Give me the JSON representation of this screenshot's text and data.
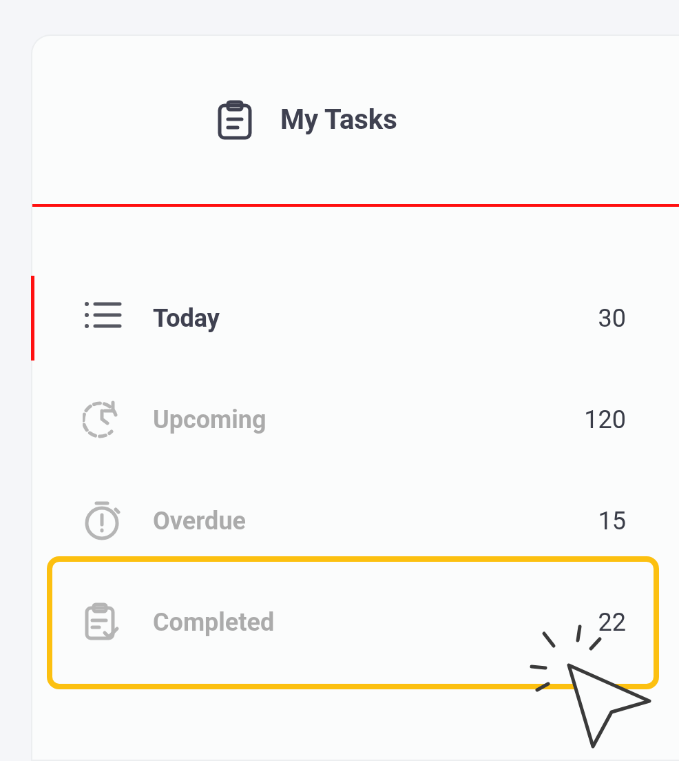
{
  "header": {
    "title": "My Tasks"
  },
  "items": [
    {
      "kind": "list",
      "label": "Today",
      "count": "30",
      "selected": true,
      "highlighted": false
    },
    {
      "kind": "upcoming",
      "label": "Upcoming",
      "count": "120",
      "selected": false,
      "highlighted": false
    },
    {
      "kind": "overdue",
      "label": "Overdue",
      "count": "15",
      "selected": false,
      "highlighted": false
    },
    {
      "kind": "completed",
      "label": "Completed",
      "count": "22",
      "selected": false,
      "highlighted": true
    }
  ]
}
